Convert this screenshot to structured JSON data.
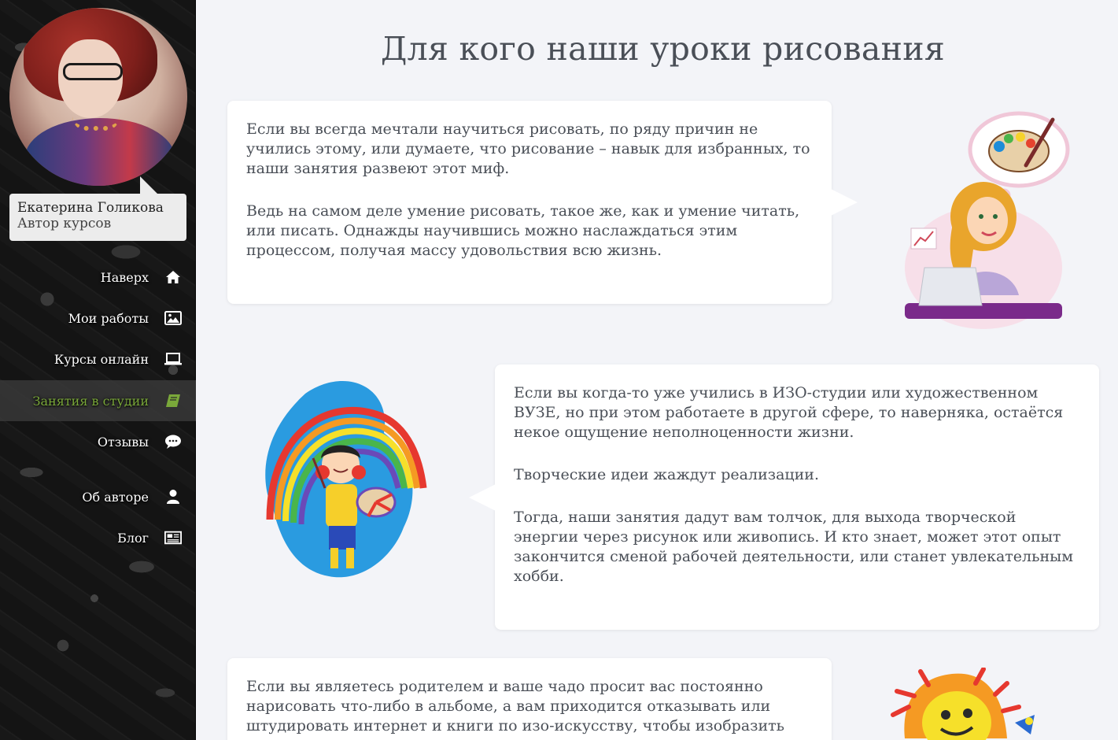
{
  "author": {
    "name": "Екатерина Голикова",
    "role": "Автор курсов"
  },
  "nav": {
    "items": [
      {
        "label": "Наверх",
        "icon": "home-icon"
      },
      {
        "label": "Мои работы",
        "icon": "image-icon"
      },
      {
        "label": "Курсы онлайн",
        "icon": "laptop-icon"
      },
      {
        "label": "Занятия в студии",
        "icon": "book-icon",
        "active": true
      },
      {
        "label": "Отзывы",
        "icon": "comment-icon"
      },
      {
        "label": "Об авторе",
        "icon": "user-icon"
      },
      {
        "label": "Блог",
        "icon": "newspaper-icon"
      }
    ],
    "active_color": "#7aa83a"
  },
  "main": {
    "title": "Для кого наши уроки рисования",
    "blocks": [
      {
        "paragraphs": [
          "Если вы всегда мечтали научиться рисовать, по ряду причин не учились этому, или думаете, что рисование – навык для избранных, то наши занятия развеют этот миф.",
          "Ведь на самом деле умение рисовать, такое же, как и умение читать, или писать. Однажды научившись можно наслаждаться этим процессом, получая массу удовольствия всю жизнь."
        ],
        "illustration": "girl-with-laptop-dreaming-of-palette"
      },
      {
        "paragraphs": [
          "Если вы когда-то уже учились в ИЗО-студии или художественном ВУЗЕ, но при этом работаете в другой сфере, то наверняка, остаётся некое ощущение неполноценности жизни.",
          "Творческие идеи жаждут реализации.",
          "Тогда, наши занятия дадут вам толчок, для выхода творческой энергии через рисунок или живопись. И кто знает, может этот опыт закончится сменой рабочей деятельности, или станет увлекательным хобби."
        ],
        "illustration": "child-painting-rainbow"
      },
      {
        "paragraphs": [
          "Если вы являетесь родителем и ваше чадо просит вас постоянно нарисовать что-либо в альбоме, а вам приходится отказывать или штудировать интернет и книги по изо-искусству, чтобы изобразить"
        ],
        "illustration": "drawn-sun"
      }
    ]
  }
}
